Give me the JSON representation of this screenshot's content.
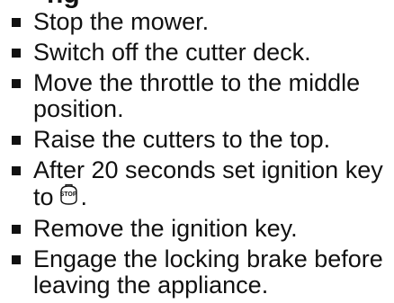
{
  "heading": "ng",
  "steps": [
    {
      "text": "Stop the mower."
    },
    {
      "text": "Switch off the cutter deck."
    },
    {
      "text": "Move the throttle to the middle position."
    },
    {
      "text": "Raise the cutters to the top."
    },
    {
      "text_before_icon": "After 20 seconds set ignition key to",
      "icon": "stop-key-icon",
      "icon_label": "STOP",
      "text_after_icon": "."
    },
    {
      "text": "Remove the ignition key."
    },
    {
      "text": "Engage the locking brake before leaving the appliance."
    }
  ],
  "colors": {
    "text": "#111111",
    "bullet": "#111111",
    "background": "#ffffff"
  }
}
